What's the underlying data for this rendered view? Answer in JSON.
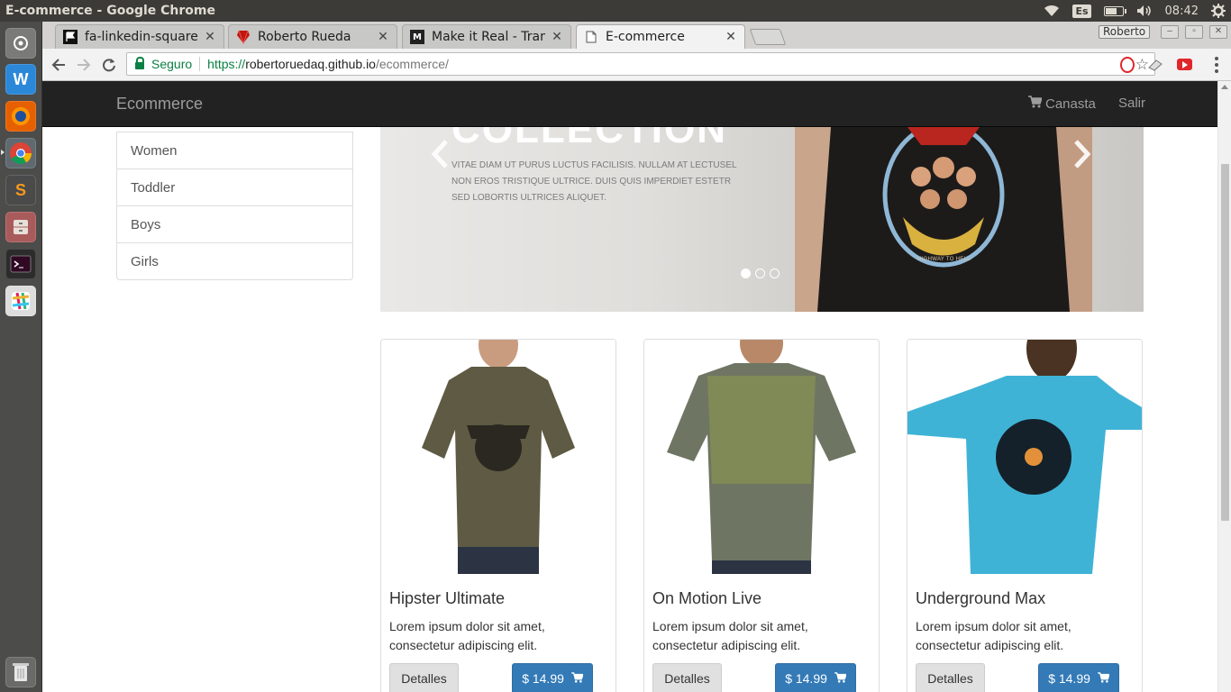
{
  "os": {
    "window_title": "E-commerce - Google Chrome",
    "keyboard_layout": "Es",
    "battery_level": 0.7,
    "clock": "08:42"
  },
  "browser": {
    "tabs": [
      {
        "title": "fa-linkedin-square:",
        "favicon": "flag-icon",
        "active": false
      },
      {
        "title": "Roberto Rueda",
        "favicon": "ruby-icon",
        "active": false
      },
      {
        "title": "Make it Real - Transl",
        "favicon": "m-icon",
        "active": false
      },
      {
        "title": "E-commerce",
        "favicon": "page-icon",
        "active": true
      }
    ],
    "profile_name": "Roberto",
    "secure_label": "Seguro",
    "url": {
      "scheme": "https://",
      "host": "robertoruedaq.github.io",
      "path": "/ecommerce/"
    }
  },
  "site": {
    "brand": "Ecommerce",
    "nav": {
      "cart_label": "Canasta",
      "logout_label": "Salir"
    },
    "categories": [
      "Women",
      "Toddler",
      "Boys",
      "Girls"
    ],
    "carousel": {
      "heading": "COLLECTION",
      "text": "VITAE DIAM UT PURUS LUCTUS FACILISIS. NULLAM AT LECTUSEL NON EROS TRISTIQUE ULTRICE. DUIS QUIS IMPERDIET ESTETR SED LOBORTIS ULTRICES ALIQUET.",
      "shirt_print": "HIGHWAY TO HELL",
      "slide_count": 3,
      "active_slide": 1
    },
    "products": [
      {
        "name": "Hipster Ultimate",
        "description": "Lorem ipsum dolor sit amet, consectetur adipiscing elit.",
        "details_label": "Detalles",
        "price": "$ 14.99",
        "shirt_color": "#5e5a43"
      },
      {
        "name": "On Motion Live",
        "description": "Lorem ipsum dolor sit amet, consectetur adipiscing elit.",
        "details_label": "Detalles",
        "price": "$ 14.99",
        "shirt_color": "#6f7563"
      },
      {
        "name": "Underground Max",
        "description": "Lorem ipsum dolor sit amet, consectetur adipiscing elit.",
        "details_label": "Detalles",
        "price": "$ 14.99",
        "shirt_color": "#3fb3d6"
      }
    ]
  },
  "colors": {
    "navbar": "#222222",
    "primary_button": "#337ab7",
    "secure_green": "#0b8043"
  }
}
